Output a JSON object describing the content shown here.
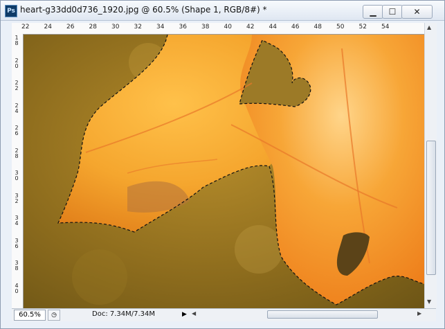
{
  "window": {
    "app_icon": "Ps",
    "title": "heart-g33dd0d736_1920.jpg @ 60.5% (Shape 1, RGB/8#) *",
    "buttons": {
      "minimize_icon": "minimize-icon",
      "maximize_icon": "maximize-icon",
      "close_icon": "close-icon"
    }
  },
  "ruler": {
    "top": [
      "22",
      "24",
      "26",
      "28",
      "30",
      "32",
      "34",
      "36",
      "38",
      "40",
      "42",
      "44",
      "46",
      "48",
      "50",
      "52",
      "54"
    ],
    "left": [
      "1\n8",
      "2\n0",
      "2\n2",
      "2\n4",
      "2\n6",
      "2\n8",
      "3\n0",
      "3\n2",
      "3\n4",
      "3\n6",
      "3\n8",
      "4\n0"
    ]
  },
  "status": {
    "zoom_value": "60.5%",
    "doc_info": "Doc: 7.34M/7.34M"
  },
  "colors": {
    "leaf": "#f09a28",
    "background": "#a07a22"
  }
}
